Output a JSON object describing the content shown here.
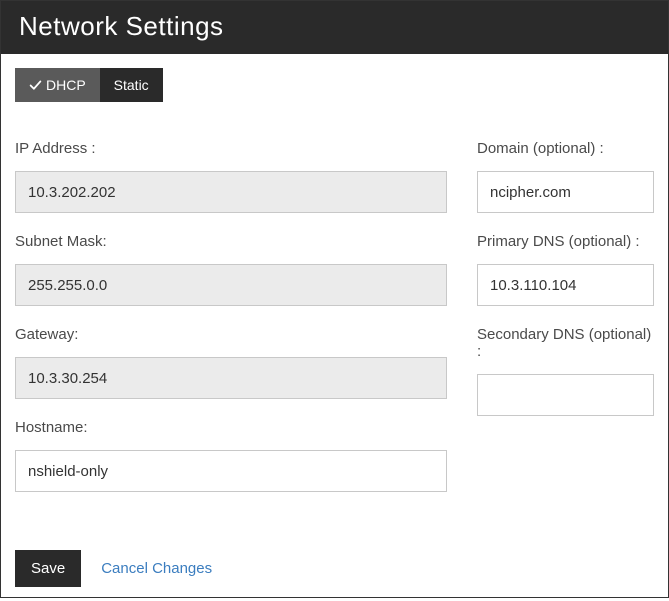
{
  "header": {
    "title": "Network Settings"
  },
  "tabs": {
    "dhcp": "DHCP",
    "static": "Static"
  },
  "labels": {
    "ip_address": "IP Address :",
    "subnet_mask": "Subnet Mask:",
    "gateway": "Gateway:",
    "hostname": "Hostname:",
    "domain": "Domain (optional) :",
    "primary_dns": "Primary DNS (optional) :",
    "secondary_dns": "Secondary DNS (optional) :"
  },
  "values": {
    "ip_address": "10.3.202.202",
    "subnet_mask": "255.255.0.0",
    "gateway": "10.3.30.254",
    "hostname": "nshield-only",
    "domain": "ncipher.com",
    "primary_dns": "10.3.110.104",
    "secondary_dns": ""
  },
  "actions": {
    "save": "Save",
    "cancel": "Cancel Changes"
  }
}
